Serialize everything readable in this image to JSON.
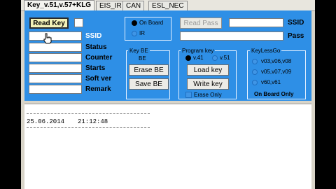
{
  "tabs": [
    "Key_v.51,v.57+KLG",
    "EIS_IR",
    "CAN",
    "ESL_NEC"
  ],
  "buttons": {
    "read_key": "Read Key",
    "read_pass": "Read Pass",
    "erase_be": "Erase BE",
    "save_be": "Save BE",
    "load_key": "Load key",
    "write_key": "Write key"
  },
  "labels": {
    "ssid": "SSID",
    "status": "Status",
    "counter": "Counter",
    "starts": "Starts",
    "soft_ver": "Soft ver",
    "remark": "Remark",
    "ssid_right": "SSID",
    "pass": "Pass"
  },
  "mode": {
    "on_board": "On Board",
    "ir": "IR"
  },
  "key_be": {
    "title": "Key BE",
    "sub": "BE"
  },
  "program_key": {
    "title": "Program key",
    "v41": "v.41",
    "v51": "v.51",
    "erase_only": "Erase Only"
  },
  "keylessgo": {
    "title": "KeyLessGo",
    "options": [
      "v03,v06,v08",
      "v05,v07,v09",
      "v60,v61"
    ],
    "on_board_only": "On Board Only"
  },
  "log": {
    "date": "25.06.2014",
    "time": "21:12:48"
  },
  "colors": {
    "panel": "#2e8fe6"
  }
}
